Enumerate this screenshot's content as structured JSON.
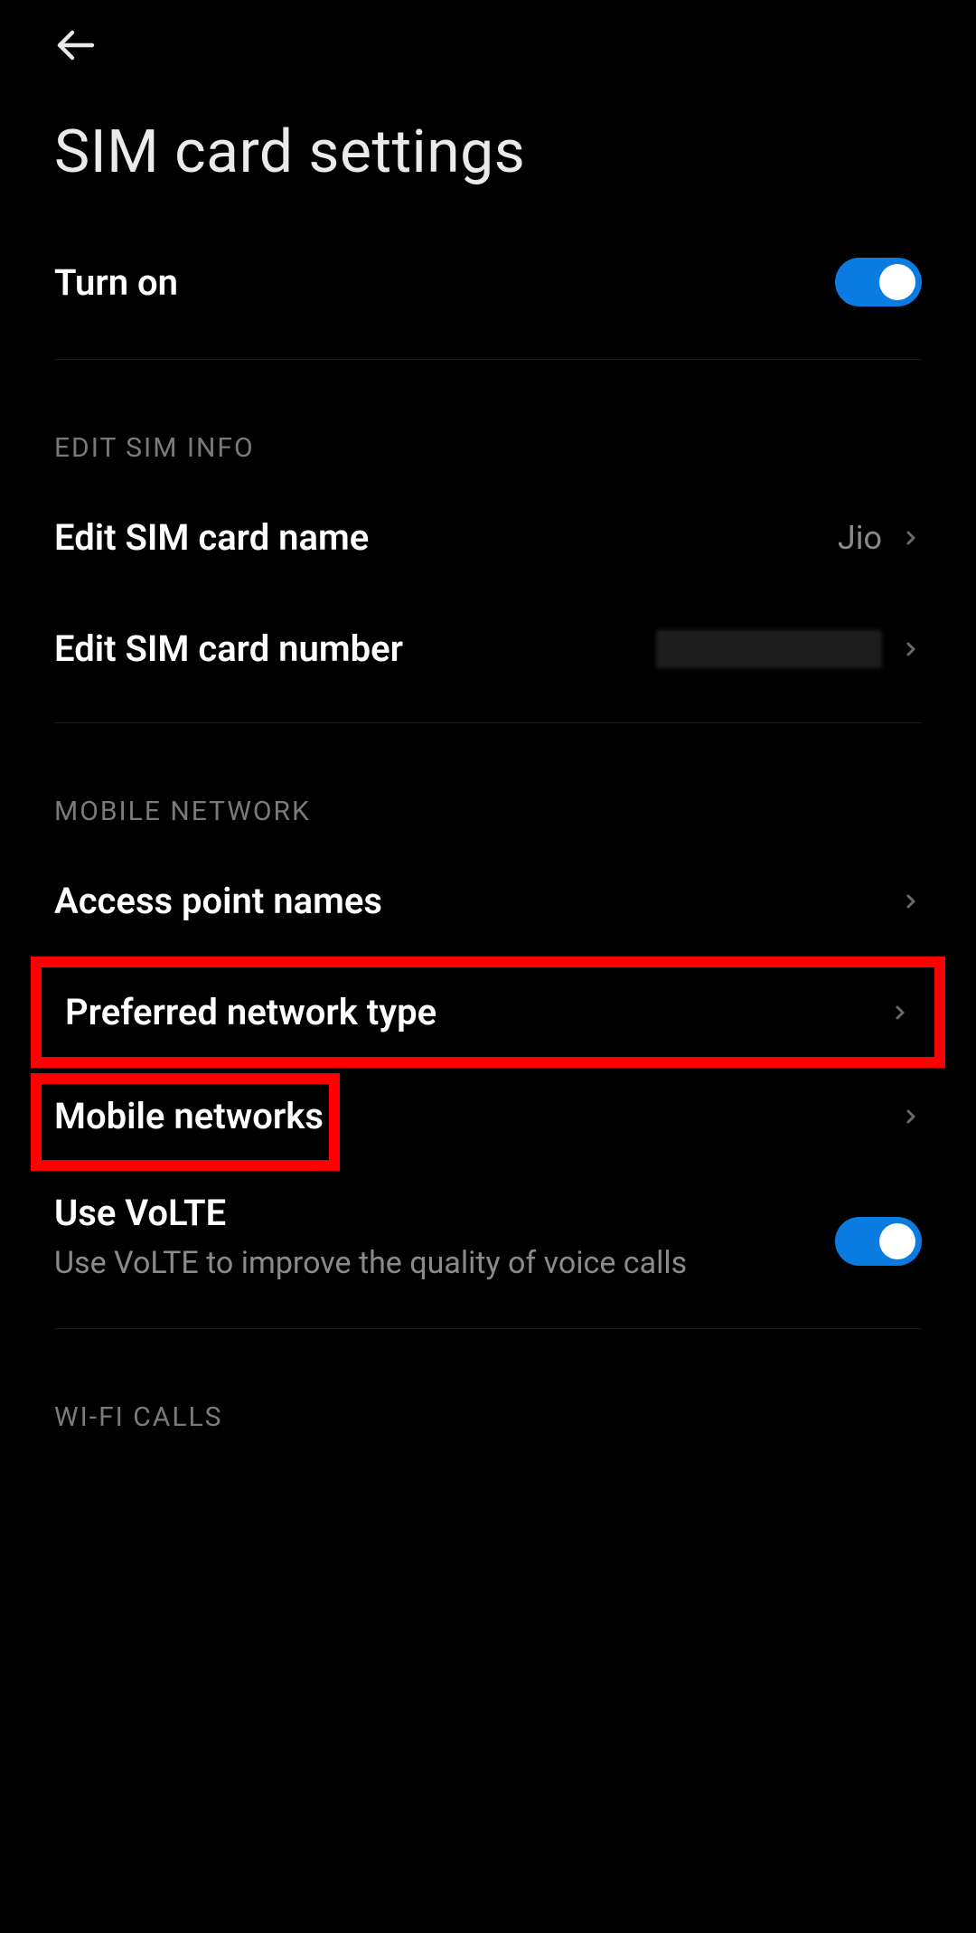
{
  "header": {
    "title": "SIM card settings"
  },
  "turnOn": {
    "label": "Turn on",
    "state": "on"
  },
  "sections": {
    "editSim": {
      "header": "EDIT SIM INFO",
      "items": {
        "name": {
          "label": "Edit SIM card name",
          "value": "Jio"
        },
        "number": {
          "label": "Edit SIM card number"
        }
      }
    },
    "mobileNetwork": {
      "header": "MOBILE NETWORK",
      "items": {
        "apn": {
          "label": "Access point names"
        },
        "preferred": {
          "label": "Preferred network type"
        },
        "mobileNetworks": {
          "label": "Mobile networks"
        },
        "volte": {
          "label": "Use VoLTE",
          "sub": "Use VoLTE to improve the quality of voice calls",
          "state": "on"
        }
      }
    },
    "wifiCalls": {
      "header": "WI-FI CALLS"
    }
  },
  "icons": {
    "back": "back-arrow-icon",
    "chevron": "chevron-right-icon"
  },
  "colors": {
    "accent": "#0a7be0",
    "highlight": "#ff0000"
  }
}
